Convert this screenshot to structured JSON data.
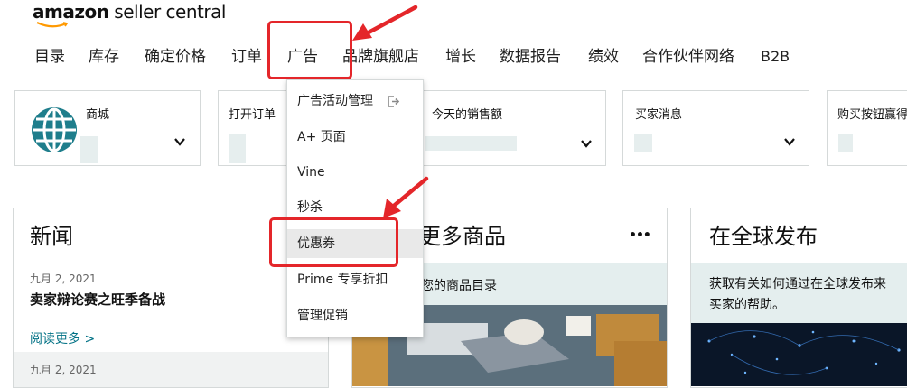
{
  "brand": {
    "name_bold": "amazon",
    "name_rest": " seller central"
  },
  "nav": [
    {
      "label": "目录"
    },
    {
      "label": "库存"
    },
    {
      "label": "确定价格"
    },
    {
      "label": "订单"
    },
    {
      "label": "广告"
    },
    {
      "label": "品牌旗舰店"
    },
    {
      "label": "增长"
    },
    {
      "label": "数据报告"
    },
    {
      "label": "绩效"
    },
    {
      "label": "合作伙伴网络"
    },
    {
      "label": "B2B"
    }
  ],
  "widgets": {
    "marketplace": {
      "title": "商城"
    },
    "open_orders": {
      "title": "打开订单"
    },
    "todays_sales": {
      "title": "今天的销售额"
    },
    "buyer_messages": {
      "title": "买家消息"
    },
    "buy_box": {
      "title": "购买按钮赢得"
    }
  },
  "dropdown": {
    "items": [
      {
        "label": "广告活动管理"
      },
      {
        "label": "A+ 页面"
      },
      {
        "label": "Vine"
      },
      {
        "label": "秒杀"
      },
      {
        "label": "优惠券"
      },
      {
        "label": "Prime 专享折扣"
      },
      {
        "label": "管理促销"
      }
    ]
  },
  "news": {
    "title": "新闻",
    "items": [
      {
        "date": "九月 2, 2021",
        "headline": "卖家辩论赛之旺季备战"
      },
      {
        "date": "九月 2, 2021"
      }
    ],
    "read_more": "阅读更多 >"
  },
  "more_products": {
    "title": "更多商品",
    "menu": "•••",
    "banner": "您的商品目录"
  },
  "global": {
    "title": "在全球发布",
    "text1": "获取有关如何通过在全球发布来",
    "text2": "买家的帮助。"
  },
  "colors": {
    "annotation_red": "#e4262a",
    "link_teal": "#007185",
    "globe_teal": "#1f7e8c"
  }
}
